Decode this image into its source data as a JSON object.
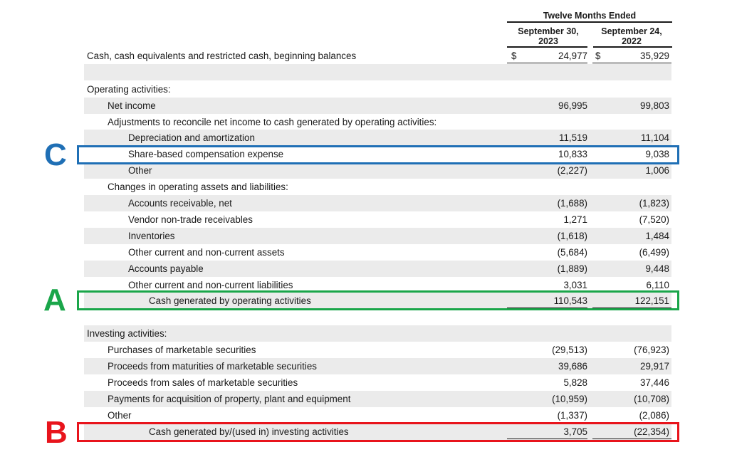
{
  "header": {
    "period": "Twelve Months Ended",
    "col1_line1": "September 30,",
    "col1_line2": "2023",
    "col2_line1": "September 24,",
    "col2_line2": "2022"
  },
  "beginning": {
    "label": "Cash, cash equivalents and restricted cash, beginning balances",
    "sym1": "$",
    "v1": "24,977",
    "sym2": "$",
    "v2": "35,929"
  },
  "operating": {
    "heading": "Operating activities:",
    "net_income": {
      "label": "Net income",
      "v1": "96,995",
      "v2": "99,803"
    },
    "adjustments_heading": "Adjustments to reconcile net income to cash generated by operating activities:",
    "depreciation": {
      "label": "Depreciation and amortization",
      "v1": "11,519",
      "v2": "11,104"
    },
    "share_based": {
      "label": "Share-based compensation expense",
      "v1": "10,833",
      "v2": "9,038"
    },
    "other": {
      "label": "Other",
      "v1": "(2,227)",
      "v2": "1,006"
    },
    "changes_heading": "Changes in operating assets and liabilities:",
    "accounts_receivable": {
      "label": "Accounts receivable, net",
      "v1": "(1,688)",
      "v2": "(1,823)"
    },
    "vendor": {
      "label": "Vendor non-trade receivables",
      "v1": "1,271",
      "v2": "(7,520)"
    },
    "inventories": {
      "label": "Inventories",
      "v1": "(1,618)",
      "v2": "1,484"
    },
    "other_assets": {
      "label": "Other current and non-current assets",
      "v1": "(5,684)",
      "v2": "(6,499)"
    },
    "accounts_payable": {
      "label": "Accounts payable",
      "v1": "(1,889)",
      "v2": "9,448"
    },
    "other_liabilities": {
      "label": "Other current and non-current liabilities",
      "v1": "3,031",
      "v2": "6,110"
    },
    "total": {
      "label": "Cash generated by operating activities",
      "v1": "110,543",
      "v2": "122,151"
    }
  },
  "investing": {
    "heading": "Investing activities:",
    "purchases": {
      "label": "Purchases of marketable securities",
      "v1": "(29,513)",
      "v2": "(76,923)"
    },
    "maturities": {
      "label": "Proceeds from maturities of marketable securities",
      "v1": "39,686",
      "v2": "29,917"
    },
    "sales": {
      "label": "Proceeds from sales of marketable securities",
      "v1": "5,828",
      "v2": "37,446"
    },
    "ppe": {
      "label": "Payments for acquisition of property, plant and equipment",
      "v1": "(10,959)",
      "v2": "(10,708)"
    },
    "other": {
      "label": "Other",
      "v1": "(1,337)",
      "v2": "(2,086)"
    },
    "total": {
      "label": "Cash generated by/(used in) investing activities",
      "v1": "3,705",
      "v2": "(22,354)"
    }
  },
  "annotations": {
    "a": {
      "letter": "A",
      "color": "#1aa64a"
    },
    "b": {
      "letter": "B",
      "color": "#e8141c"
    },
    "c": {
      "letter": "C",
      "color": "#1f6fb5"
    }
  }
}
